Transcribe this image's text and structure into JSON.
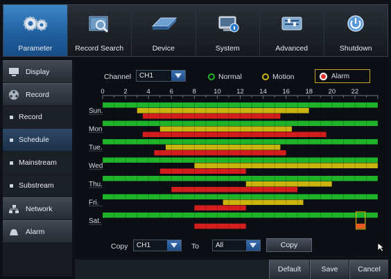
{
  "topnav": [
    {
      "label": "Parameter",
      "icon": "gear-icon",
      "active": true
    },
    {
      "label": "Record Search",
      "icon": "film-search-icon",
      "active": false
    },
    {
      "label": "Device",
      "icon": "hard-drive-icon",
      "active": false
    },
    {
      "label": "System",
      "icon": "monitor-info-icon",
      "active": false
    },
    {
      "label": "Advanced",
      "icon": "settings-panel-icon",
      "active": false
    },
    {
      "label": "Shutdown",
      "icon": "power-icon",
      "active": false
    }
  ],
  "sidebar": [
    {
      "label": "Display",
      "type": "group",
      "icon": "display-icon"
    },
    {
      "label": "Record",
      "type": "group",
      "icon": "record-reel-icon"
    },
    {
      "label": "Record",
      "type": "sub"
    },
    {
      "label": "Schedule",
      "type": "sub",
      "active": true
    },
    {
      "label": "Mainstream",
      "type": "sub"
    },
    {
      "label": "Substream",
      "type": "sub"
    },
    {
      "label": "Network",
      "type": "group",
      "icon": "network-icon"
    },
    {
      "label": "Alarm",
      "type": "group",
      "icon": "alarm-icon"
    }
  ],
  "schedule": {
    "channel_label": "Channel",
    "channel_value": "CH1",
    "legend": {
      "normal": "Normal",
      "motion": "Motion",
      "alarm": "Alarm",
      "selected": "alarm"
    },
    "colors": {
      "normal": "#1fb32a",
      "motion": "#c8b40c",
      "alarm": "#d41e1e"
    },
    "hour_ticks": [
      "0",
      "2",
      "4",
      "6",
      "8",
      "10",
      "12",
      "14",
      "16",
      "18",
      "20",
      "22"
    ],
    "days": [
      {
        "label": "Sun.",
        "normal": [
          [
            0,
            24
          ]
        ],
        "motion": [
          [
            3,
            18
          ]
        ],
        "alarm": [
          [
            3.5,
            15.5
          ]
        ]
      },
      {
        "label": "Mon",
        "normal": [
          [
            0,
            24
          ]
        ],
        "motion": [
          [
            5,
            16.5
          ]
        ],
        "alarm": [
          [
            3.5,
            19.5
          ]
        ]
      },
      {
        "label": "Tue.",
        "normal": [
          [
            0,
            24
          ]
        ],
        "motion": [
          [
            5.5,
            15.5
          ]
        ],
        "alarm": [
          [
            4.5,
            16
          ]
        ]
      },
      {
        "label": "Wed",
        "normal": [
          [
            0,
            24
          ]
        ],
        "motion": [
          [
            8,
            24
          ]
        ],
        "alarm": [
          [
            5,
            12.5
          ]
        ]
      },
      {
        "label": "Thu.",
        "normal": [
          [
            0,
            24
          ]
        ],
        "motion": [
          [
            12.5,
            20
          ]
        ],
        "alarm": [
          [
            6,
            17
          ]
        ]
      },
      {
        "label": "Fri.",
        "normal": [
          [
            0,
            24
          ]
        ],
        "motion": [
          [
            10.5,
            17.5
          ]
        ],
        "alarm": [
          [
            8,
            12.5
          ]
        ]
      },
      {
        "label": "Sat.",
        "normal": [
          [
            0,
            24
          ]
        ],
        "motion": [],
        "alarm": [
          [
            8,
            12.5
          ]
        ]
      }
    ],
    "copy_label": "Copy",
    "copy_from": "CH1",
    "to_label": "To",
    "copy_to": "All",
    "copy_button": "Copy"
  },
  "footer": {
    "default": "Default",
    "save": "Save",
    "cancel": "Cancel"
  }
}
